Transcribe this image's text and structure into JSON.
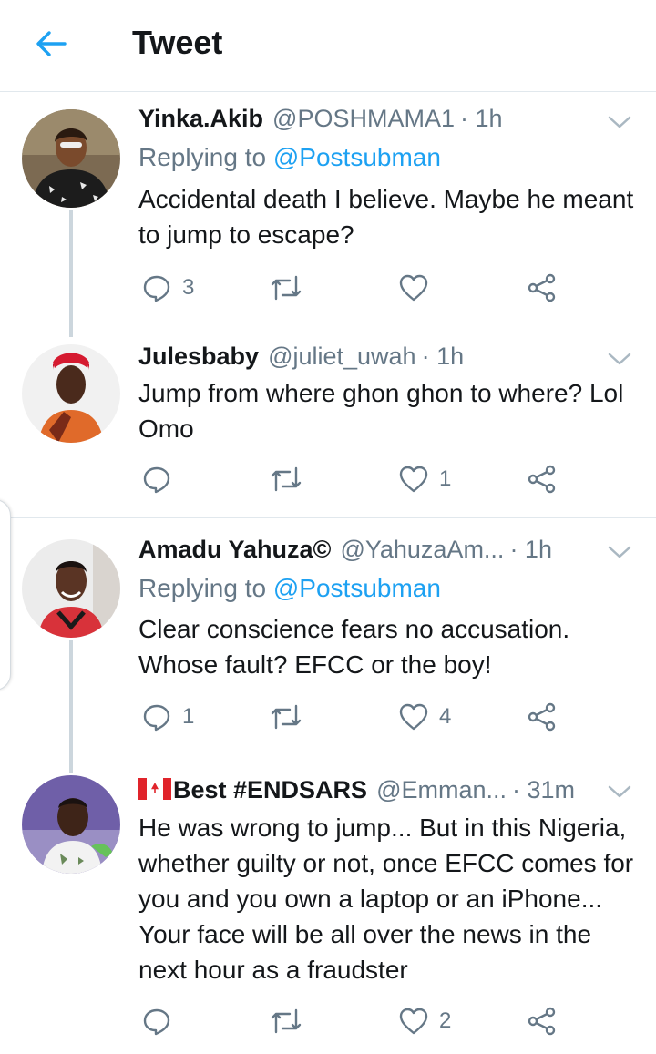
{
  "header": {
    "title": "Tweet",
    "back_icon": "arrow-left-icon",
    "accent": "#1da1f2"
  },
  "tweets": [
    {
      "name": "Yinka.Akib",
      "handle": "@POSHMAMA1",
      "time": "· 1h",
      "replying_prefix": "Replying to ",
      "replying_to": "@Postsubman",
      "text": "Accidental death I believe. Maybe he meant to jump to escape?",
      "reply_count": "3",
      "retweet_count": "",
      "like_count": ""
    },
    {
      "name": "Julesbaby",
      "handle": "@juliet_uwah",
      "time": "· 1h",
      "text": "Jump from where ghon ghon to where? Lol Omo",
      "reply_count": "",
      "retweet_count": "",
      "like_count": "1"
    },
    {
      "name": "Amadu Yahuza©",
      "handle": "@YahuzaAm...",
      "time": "· 1h",
      "replying_prefix": "Replying to ",
      "replying_to": "@Postsubman",
      "text": "Clear conscience fears no accusation. Whose fault? EFCC or the boy!",
      "reply_count": "1",
      "retweet_count": "",
      "like_count": "4"
    },
    {
      "name": "Best #ENDSARS",
      "flag_icon": "canada-flag-icon",
      "handle": "@Emman...",
      "time": "· 31m",
      "text": "He was wrong to jump... But in this Nigeria, whether guilty or not, once EFCC comes for you and you own a laptop or an iPhone... Your face will be all over the news in the next hour as a fraudster",
      "reply_count": "",
      "retweet_count": "",
      "like_count": "2"
    }
  ]
}
